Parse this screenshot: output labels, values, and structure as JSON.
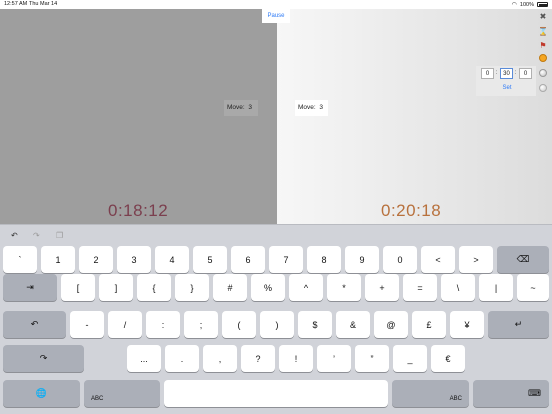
{
  "status_bar": {
    "time": "12:57 AM",
    "date": "Thu Mar 14",
    "battery": "100%"
  },
  "clock": {
    "pause_label": "Pause",
    "left": {
      "move_label": "Move:",
      "move_value": "3",
      "time": "0:18:12"
    },
    "right": {
      "move_label": "Move:",
      "move_value": "3",
      "time": "0:20:18"
    }
  },
  "time_setter": {
    "hours": "0",
    "minutes": "30",
    "seconds": "0",
    "set_label": "Set"
  },
  "icons": {
    "tools": [
      "wrench-icon",
      "hourglass-icon",
      "flag-icon",
      "coin-icon",
      "sphere-icon",
      "dot-icon"
    ],
    "undo": "undo-icon",
    "redo": "redo-icon",
    "paste": "paste-icon"
  },
  "keyboard": {
    "row1": [
      "`",
      "1",
      "2",
      "3",
      "4",
      "5",
      "6",
      "7",
      "8",
      "9",
      "0",
      "<",
      ">"
    ],
    "row1_delete": "⌫",
    "row2_tab": "⇥",
    "row2": [
      "[",
      "]",
      "{",
      "}",
      "#",
      "%",
      "^",
      "*",
      "+",
      "=",
      "\\",
      "|",
      "~"
    ],
    "row3_undo": "↶",
    "row3": [
      "-",
      "/",
      ":",
      ";",
      "(",
      ")",
      "$",
      "&",
      "@",
      "£",
      "¥"
    ],
    "row3_return": "↵",
    "row4_redo": "↷",
    "row4": [
      "...",
      ".",
      ",",
      "?",
      "!",
      "’",
      "”",
      "_",
      "€"
    ],
    "row5_globe": "🌐",
    "row5_abc_left": "ABC",
    "row5_space": "",
    "row5_abc_right": "ABC",
    "row5_dismiss": "⌨"
  }
}
